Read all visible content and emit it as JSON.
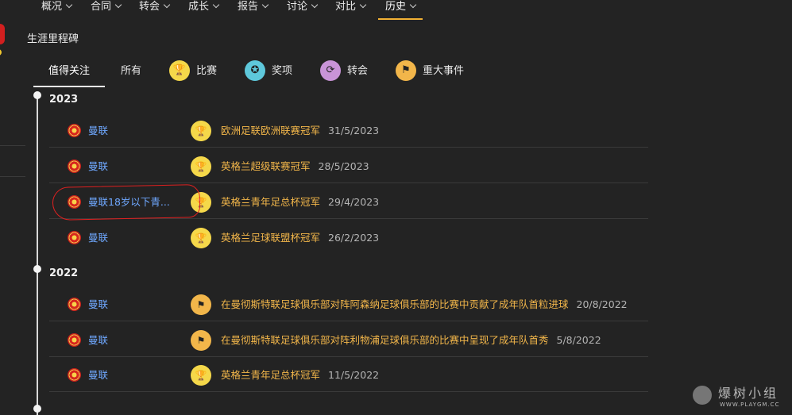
{
  "nav": {
    "items": [
      {
        "label": "概况",
        "active": false
      },
      {
        "label": "合同",
        "active": false
      },
      {
        "label": "转会",
        "active": false
      },
      {
        "label": "成长",
        "active": false
      },
      {
        "label": "报告",
        "active": false
      },
      {
        "label": "讨论",
        "active": false
      },
      {
        "label": "对比",
        "active": false
      },
      {
        "label": "历史",
        "active": true
      }
    ]
  },
  "page": {
    "title": "生涯里程碑"
  },
  "filters": {
    "tabs": [
      {
        "label": "值得关注",
        "icon": "",
        "active": true
      },
      {
        "label": "所有",
        "icon": ""
      },
      {
        "label": "比赛",
        "icon": "trophy-icon"
      },
      {
        "label": "奖项",
        "icon": "award-icon"
      },
      {
        "label": "转会",
        "icon": "transfer-icon"
      },
      {
        "label": "重大事件",
        "icon": "flag-icon"
      }
    ]
  },
  "timeline": {
    "years": [
      {
        "year": "2023",
        "rows": [
          {
            "club": "曼联",
            "icon": "trophy-icon",
            "text": "欧洲足联欧洲联赛冠军",
            "date": "31/5/2023"
          },
          {
            "club": "曼联",
            "icon": "trophy-icon",
            "text": "英格兰超级联赛冠军",
            "date": "28/5/2023"
          },
          {
            "club": "曼联18岁以下青...",
            "icon": "trophy-icon",
            "text": "英格兰青年足总杯冠军",
            "date": "29/4/2023"
          },
          {
            "club": "曼联",
            "icon": "trophy-icon",
            "text": "英格兰足球联盟杯冠军",
            "date": "26/2/2023"
          }
        ]
      },
      {
        "year": "2022",
        "rows": [
          {
            "club": "曼联",
            "icon": "flag-icon",
            "text": "在曼彻斯特联足球俱乐部对阵阿森纳足球俱乐部的比赛中贡献了成年队首粒进球",
            "date": "20/8/2022"
          },
          {
            "club": "曼联",
            "icon": "flag-icon",
            "text": "在曼彻斯特联足球俱乐部对阵利物浦足球俱乐部的比赛中呈现了成年队首秀",
            "date": "5/8/2022"
          },
          {
            "club": "曼联",
            "icon": "trophy-icon",
            "text": "英格兰青年足总杯冠军",
            "date": "11/5/2022"
          }
        ]
      }
    ]
  },
  "watermark": {
    "text": "爆树小组",
    "url": "WWW.PLAYGM.CC"
  },
  "colors": {
    "accent": "#f2b134",
    "link": "#6fa8ff",
    "event_text": "#f2b64a",
    "background": "#232323"
  }
}
